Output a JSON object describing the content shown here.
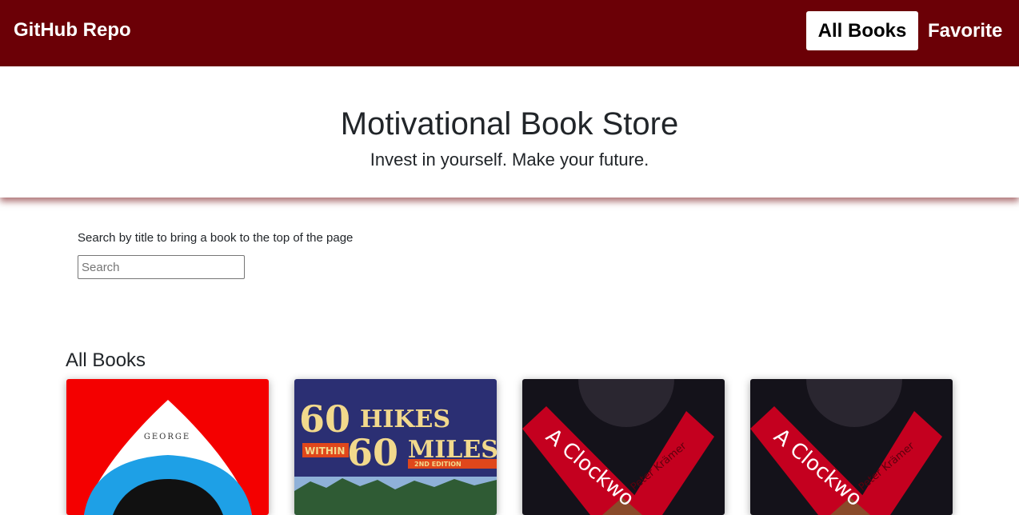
{
  "navbar": {
    "brand": "GitHub Repo",
    "links": [
      "All Books",
      "Favorite"
    ],
    "background": "#6b0006"
  },
  "hero": {
    "title": "Motivational Book Store",
    "subtitle": "Invest in yourself. Make your future."
  },
  "search": {
    "label": "Search by title to bring a book to the top of the page",
    "placeholder": "Search",
    "value": ""
  },
  "section": {
    "title": "All Books"
  },
  "books": [
    {
      "cover_text_top": "GEORGE",
      "cover_color": "#f40000"
    },
    {
      "cover_line1_num": "60",
      "cover_line1_word": "HIKES",
      "cover_within": "WITHIN",
      "cover_line2_num": "60",
      "cover_line2_word": "MILES",
      "cover_edition": "2ND EDITION",
      "cover_color": "#2b2f73"
    },
    {
      "cover_title": "A Clockwo",
      "cover_author": "Peter Krämer",
      "cover_color": "#c4001f"
    },
    {
      "cover_title": "A Clockwo",
      "cover_author": "Peter Krämer",
      "cover_color": "#c4001f"
    }
  ]
}
